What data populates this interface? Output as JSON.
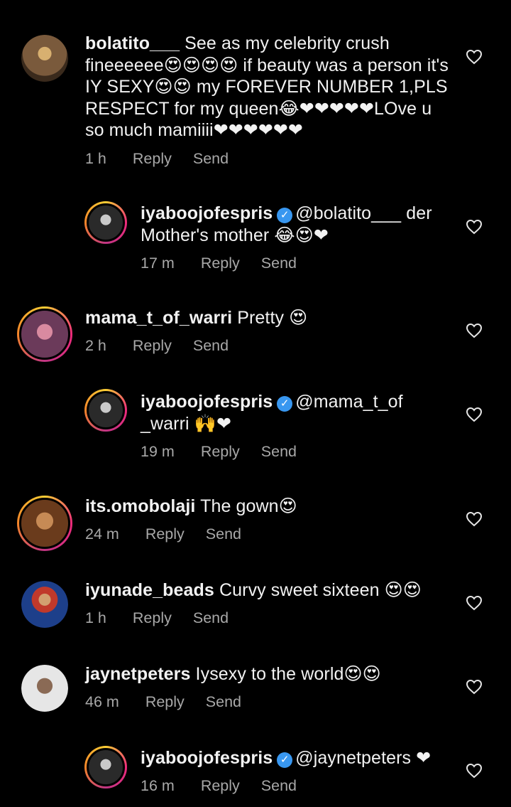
{
  "comments": [
    {
      "username": "bolatito___",
      "verified": false,
      "text": " See as my celebrity crush fineeeeee😍😍😍😍 if beauty was a person it's IY SEXY😍😍 my FOREVER NUMBER 1,PLS RESPECT for my queen😂❤❤❤❤❤LOve u so much mamiiii❤❤❤❤❤❤",
      "time": "1 h",
      "reply": "Reply",
      "send": "Send",
      "avatar_colors": [
        "#7a5a3c",
        "#d8b070"
      ],
      "story_ring": false
    },
    {
      "username": "iyaboojofespris",
      "verified": true,
      "text": "@bolatito___ der Mother's mother 😂😍❤",
      "time": "17 m",
      "reply": "Reply",
      "send": "Send",
      "avatar_colors": [
        "#2a2a2a",
        "#c9c9c9"
      ],
      "story_ring": true
    },
    {
      "username": "mama_t_of_warri",
      "verified": false,
      "text": " Pretty 😍",
      "time": "2 h",
      "reply": "Reply",
      "send": "Send",
      "avatar_colors": [
        "#6b3a5a",
        "#d98aa0"
      ],
      "story_ring": true
    },
    {
      "username": "iyaboojofespris",
      "verified": true,
      "text": "@mama_t_of _warri 🙌❤",
      "time": "19 m",
      "reply": "Reply",
      "send": "Send",
      "avatar_colors": [
        "#2a2a2a",
        "#c9c9c9"
      ],
      "story_ring": true
    },
    {
      "username": "its.omobolaji",
      "verified": false,
      "text": " The gown😍",
      "time": "24 m",
      "reply": "Reply",
      "send": "Send",
      "avatar_colors": [
        "#6a3b1c",
        "#c68a55"
      ],
      "story_ring": true
    },
    {
      "username": "iyunade_beads",
      "verified": false,
      "text": " Curvy sweet sixteen 😍😍",
      "time": "1 h",
      "reply": "Reply",
      "send": "Send",
      "avatar_colors": [
        "#1d3f8a",
        "#c0392b"
      ],
      "story_ring": false
    },
    {
      "username": "jaynetpeters",
      "verified": false,
      "text": " Iysexy to the world😍😍",
      "time": "46 m",
      "reply": "Reply",
      "send": "Send",
      "avatar_colors": [
        "#e6e6e6",
        "#8a6a55"
      ],
      "story_ring": false
    },
    {
      "username": "iyaboojofespris",
      "verified": true,
      "text": "@jaynetpeters ❤",
      "time": "16 m",
      "reply": "Reply",
      "send": "Send",
      "avatar_colors": [
        "#2a2a2a",
        "#c9c9c9"
      ],
      "story_ring": true
    }
  ],
  "icons": {
    "like": "heart-outline-icon",
    "verified": "verified-badge-icon"
  },
  "colors": {
    "background": "#000000",
    "text": "#f2f2f2",
    "meta": "#a8a8a8",
    "verified": "#3897f0",
    "story_ring_start": "#f9ce34",
    "story_ring_end": "#ee2a7b"
  }
}
